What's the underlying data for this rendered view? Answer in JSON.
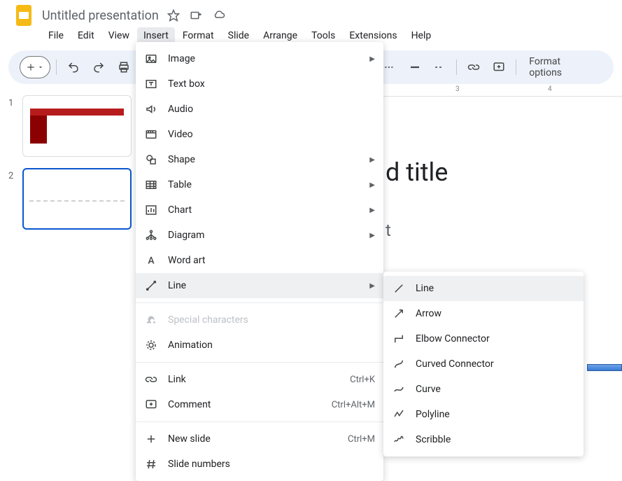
{
  "header": {
    "doc_title": "Untitled presentation"
  },
  "menubar": {
    "items": [
      "File",
      "Edit",
      "View",
      "Insert",
      "Format",
      "Slide",
      "Arrange",
      "Tools",
      "Extensions",
      "Help"
    ],
    "active_index": 3
  },
  "toolbar": {
    "format_options": "Format options"
  },
  "ruler": {
    "marks": [
      {
        "pos": 650,
        "label": "3"
      },
      {
        "pos": 782,
        "label": "4"
      }
    ]
  },
  "slide": {
    "title_fragment": "d title",
    "subtitle_fragment": "t"
  },
  "thumbs": [
    {
      "num": "1",
      "selected": false
    },
    {
      "num": "2",
      "selected": true
    }
  ],
  "insert_menu": {
    "groups": [
      [
        {
          "icon": "image",
          "label": "Image",
          "submenu": true
        },
        {
          "icon": "textbox",
          "label": "Text box"
        },
        {
          "icon": "audio",
          "label": "Audio"
        },
        {
          "icon": "video",
          "label": "Video"
        },
        {
          "icon": "shape",
          "label": "Shape",
          "submenu": true
        },
        {
          "icon": "table",
          "label": "Table",
          "submenu": true
        },
        {
          "icon": "chart",
          "label": "Chart",
          "submenu": true
        },
        {
          "icon": "diagram",
          "label": "Diagram",
          "submenu": true
        },
        {
          "icon": "wordart",
          "label": "Word art"
        },
        {
          "icon": "line",
          "label": "Line",
          "submenu": true,
          "hover": true
        }
      ],
      [
        {
          "icon": "omega",
          "label": "Special characters",
          "disabled": true
        },
        {
          "icon": "animation",
          "label": "Animation"
        }
      ],
      [
        {
          "icon": "link",
          "label": "Link",
          "shortcut": "Ctrl+K"
        },
        {
          "icon": "comment",
          "label": "Comment",
          "shortcut": "Ctrl+Alt+M"
        }
      ],
      [
        {
          "icon": "plus",
          "label": "New slide",
          "shortcut": "Ctrl+M"
        },
        {
          "icon": "hash",
          "label": "Slide numbers"
        }
      ]
    ]
  },
  "line_submenu": {
    "items": [
      {
        "icon": "line-plain",
        "label": "Line",
        "hover": true
      },
      {
        "icon": "arrow",
        "label": "Arrow"
      },
      {
        "icon": "elbow",
        "label": "Elbow Connector"
      },
      {
        "icon": "curved",
        "label": "Curved Connector"
      },
      {
        "icon": "curve",
        "label": "Curve"
      },
      {
        "icon": "polyline",
        "label": "Polyline"
      },
      {
        "icon": "scribble",
        "label": "Scribble"
      }
    ]
  }
}
